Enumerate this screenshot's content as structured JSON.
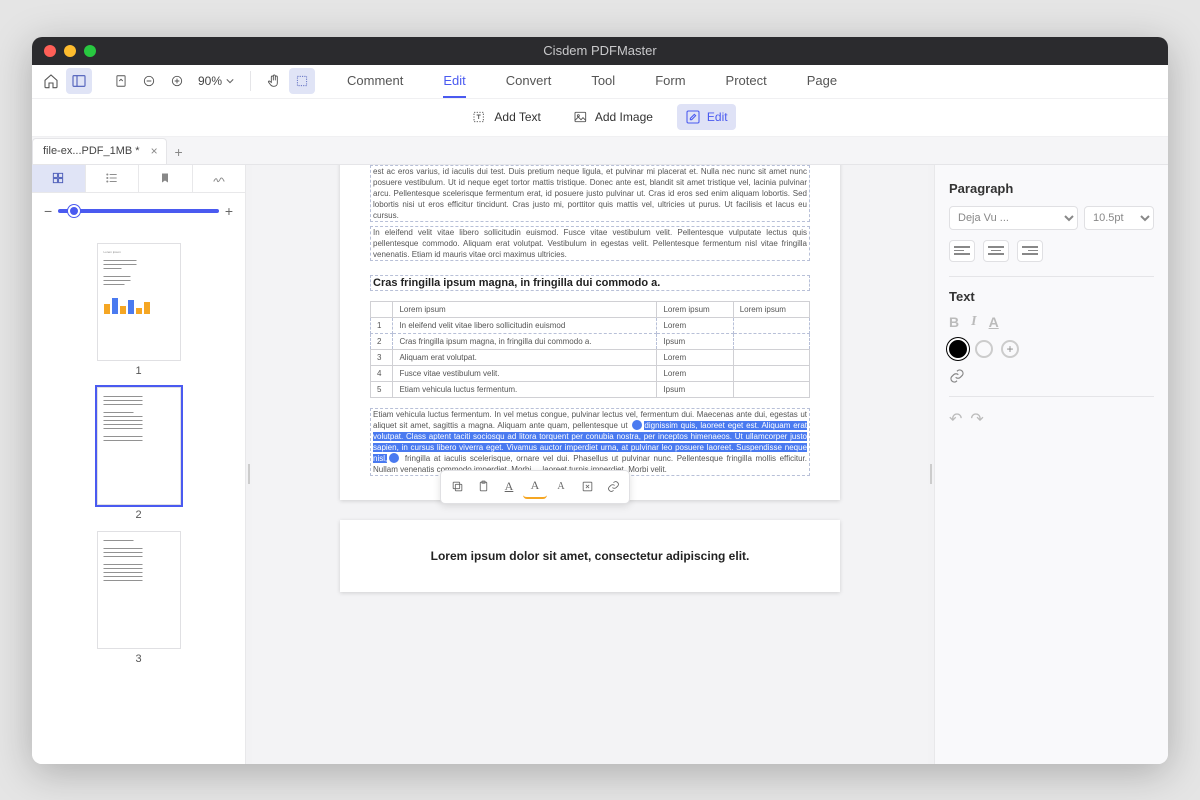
{
  "title": "Cisdem PDFMaster",
  "zoom": "90%",
  "menu": [
    "Comment",
    "Edit",
    "Convert",
    "Tool",
    "Form",
    "Protect",
    "Page"
  ],
  "menu_active": 1,
  "subtool": {
    "addText": "Add Text",
    "addImage": "Add Image",
    "edit": "Edit"
  },
  "doc_tab": "file-ex...PDF_1MB *",
  "thumbnails": [
    "1",
    "2",
    "3"
  ],
  "page": {
    "block1": "est ac eros varius, id iaculis dui test. Duis pretium neque ligula, et pulvinar mi placerat et. Nulla nec nunc sit amet nunc posuere vestibulum. Ut id neque eget tortor mattis tristique. Donec ante est, blandit sit amet tristique vel, lacinia pulvinar arcu. Pellentesque scelerisque fermentum erat, id posuere justo pulvinar ut. Cras id eros sed enim aliquam lobortis. Sed lobortis nisi ut eros efficitur tincidunt. Cras justo mi, porttitor quis mattis vel, ultricies ut purus. Ut facilisis et lacus eu cursus.",
    "block2": "In eleifend velit vitae libero sollicitudin euismod. Fusce vitae vestibulum velit. Pellentesque vulputate lectus quis pellentesque commodo. Aliquam erat volutpat. Vestibulum in egestas velit. Pellentesque fermentum nisl vitae fringilla venenatis. Etiam id mauris vitae orci maximus ultricies.",
    "heading": "Cras fringilla ipsum magna, in fringilla dui commodo a.",
    "table": {
      "header": [
        "",
        "Lorem ipsum",
        "Lorem ipsum",
        "Lorem ipsum"
      ],
      "rows": [
        [
          "1",
          "In eleifend velit vitae libero sollicitudin euismod",
          "Lorem",
          ""
        ],
        [
          "2",
          "Cras fringilla ipsum magna, in fringilla dui commodo a.",
          "Ipsum",
          ""
        ],
        [
          "3",
          "Aliquam erat volutpat.",
          "Lorem",
          ""
        ],
        [
          "4",
          "Fusce vitae vestibulum velit.",
          "Lorem",
          ""
        ],
        [
          "5",
          "Etiam vehicula luctus fermentum.",
          "Ipsum",
          ""
        ]
      ]
    },
    "para_pre": "Etiam vehicula luctus fermentum. In vel metus congue, pulvinar lectus vel, fermentum dui. Maecenas ante dui, egestas ut aliquet sit amet, sagittis a magna. Aliquam ante quam, pellentesque ut ",
    "para_hl": "dignissim quis, laoreet eget est. Aliquam erat volutpat. Class aptent taciti sociosqu ad litora torquent per conubia nostra, per inceptos himenaeos. Ut ullamcorper justo sapien, in cursus libero viverra eget. Vivamus auctor imperdiet urna, at pulvinar leo posuere laoreet. Suspendisse neque nisl,",
    "para_post": " fringilla at iaculis scelerisque, ornare vel dui. Phasellus ut pulvinar nunc. Pellentesque fringilla mollis efficitur. Nullam venenatis commodo imperdiet. Morbi ... laoreet turpis imperdiet. Morbi velit.",
    "page2title": "Lorem ipsum dolor sit amet, consectetur adipiscing elit."
  },
  "props": {
    "paragraph": "Paragraph",
    "font": "Deja Vu ...",
    "size": "10.5pt",
    "text": "Text"
  }
}
